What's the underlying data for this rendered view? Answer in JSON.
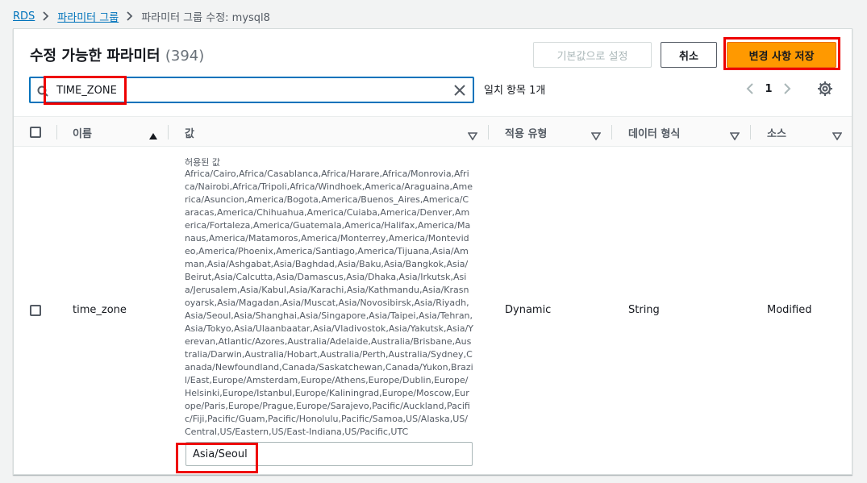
{
  "breadcrumb": {
    "items": [
      "RDS",
      "파라미터 그룹"
    ],
    "current": "파라미터 그룹 수정: mysql8"
  },
  "header": {
    "title": "수정 가능한 파라미터",
    "count": "(394)"
  },
  "toolbar": {
    "default_label": "기본값으로 설정",
    "cancel_label": "취소",
    "save_label": "변경 사항 저장"
  },
  "search": {
    "value": "TIME_ZONE",
    "matches": "일치 항목 1개"
  },
  "pagination": {
    "current_page": "1"
  },
  "table": {
    "columns": [
      "이름",
      "값",
      "적용 유형",
      "데이터 형식",
      "소스"
    ],
    "rows": [
      {
        "name": "time_zone",
        "allowed_label": "허용된 값",
        "allowed_values": "Africa/Cairo,Africa/Casablanca,Africa/Harare,Africa/Monrovia,Africa/Nairobi,Africa/Tripoli,Africa/Windhoek,America/Araguaina,America/Asuncion,America/Bogota,America/Buenos_Aires,America/Caracas,America/Chihuahua,America/Cuiaba,America/Denver,America/Fortaleza,America/Guatemala,America/Halifax,America/Manaus,America/Matamoros,America/Monterrey,America/Montevideo,America/Phoenix,America/Santiago,America/Tijuana,Asia/Amman,Asia/Ashgabat,Asia/Baghdad,Asia/Baku,Asia/Bangkok,Asia/Beirut,Asia/Calcutta,Asia/Damascus,Asia/Dhaka,Asia/Irkutsk,Asia/Jerusalem,Asia/Kabul,Asia/Karachi,Asia/Kathmandu,Asia/Krasnoyarsk,Asia/Magadan,Asia/Muscat,Asia/Novosibirsk,Asia/Riyadh,Asia/Seoul,Asia/Shanghai,Asia/Singapore,Asia/Taipei,Asia/Tehran,Asia/Tokyo,Asia/Ulaanbaatar,Asia/Vladivostok,Asia/Yakutsk,Asia/Yerevan,Atlantic/Azores,Australia/Adelaide,Australia/Brisbane,Australia/Darwin,Australia/Hobart,Australia/Perth,Australia/Sydney,Canada/Newfoundland,Canada/Saskatchewan,Canada/Yukon,Brazil/East,Europe/Amsterdam,Europe/Athens,Europe/Dublin,Europe/Helsinki,Europe/Istanbul,Europe/Kaliningrad,Europe/Moscow,Europe/Paris,Europe/Prague,Europe/Sarajevo,Pacific/Auckland,Pacific/Fiji,Pacific/Guam,Pacific/Honolulu,Pacific/Samoa,US/Alaska,US/Central,US/Eastern,US/East-Indiana,US/Pacific,UTC",
        "value": "Asia/Seoul",
        "apply_type": "Dynamic",
        "data_type": "String",
        "source": "Modified"
      }
    ]
  },
  "colors": {
    "link": "#0073bb",
    "primary_button": "#ff9900",
    "highlight": "#ee0000"
  }
}
